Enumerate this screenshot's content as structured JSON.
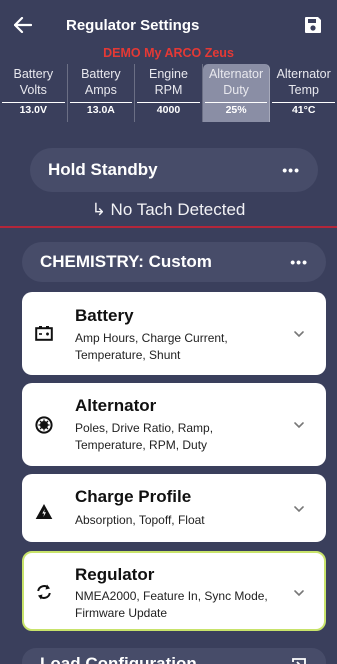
{
  "header": {
    "title": "Regulator Settings",
    "back_icon": "arrow-left-icon",
    "save_icon": "floppy-disk-icon"
  },
  "device_name": "DEMO My ARCO Zeus",
  "metrics": [
    {
      "label_line1": "Battery",
      "label_line2": "Volts",
      "value": "13.0V",
      "active": false
    },
    {
      "label_line1": "Battery",
      "label_line2": "Amps",
      "value": "13.0A",
      "active": false
    },
    {
      "label_line1": "Engine",
      "label_line2": "RPM",
      "value": "4000",
      "active": false
    },
    {
      "label_line1": "Alternator",
      "label_line2": "Duty",
      "value": "25%",
      "active": true
    },
    {
      "label_line1": "Alternator",
      "label_line2": "Temp",
      "value": "41°C",
      "active": false
    }
  ],
  "mode_pill": {
    "label": "Hold Standby",
    "menu": "•••"
  },
  "tach_status": "↳ No Tach Detected",
  "chemistry_pill": {
    "label": "CHEMISTRY: Custom",
    "menu": "•••"
  },
  "cards": [
    {
      "title": "Battery",
      "description": "Amp Hours, Charge Current, Temperature, Shunt",
      "icon": "battery-icon"
    },
    {
      "title": "Alternator",
      "description": "Poles, Drive Ratio, Ramp, Temperature, RPM, Duty",
      "icon": "alternator-icon"
    },
    {
      "title": "Charge Profile",
      "description": "Absorption, Topoff, Float",
      "icon": "warning-bolt-icon"
    },
    {
      "title": "Regulator",
      "description": "NMEA2000, Feature In, Sync Mode, Firmware Update",
      "icon": "sync-icon"
    }
  ],
  "load_config": {
    "label": "Load Configuration",
    "icon": "import-icon"
  },
  "colors": {
    "background": "#3a3f5c",
    "pill": "#474c69",
    "device_red": "#e53935",
    "divider_red": "#b3263a",
    "active_metric": "#8a8ea5",
    "highlight_border": "#c8e36b"
  }
}
